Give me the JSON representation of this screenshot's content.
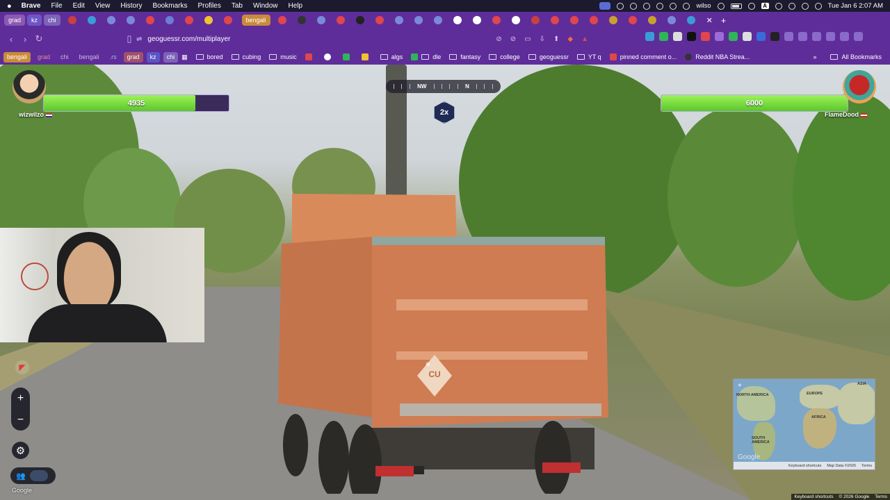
{
  "menubar": {
    "apple": "",
    "items": [
      "Brave",
      "File",
      "Edit",
      "View",
      "History",
      "Bookmarks",
      "Profiles",
      "Tab",
      "Window",
      "Help"
    ],
    "user": "wilso",
    "clock": "Tue Jan 6  2:07 AM",
    "input_badge": "A"
  },
  "tabs": {
    "group_grad": "grad",
    "group_kz": "kz",
    "group_chi": "chi",
    "group_bengali": "bengali"
  },
  "toolbar": {
    "url": "geoguessr.com/multiplayer"
  },
  "bookmarks": {
    "chips": [
      "bengali",
      "grad",
      "chi",
      "bengali",
      ".rs",
      "grad",
      "kz",
      "chi"
    ],
    "items": [
      "bored",
      "cubing",
      "music",
      "",
      "",
      "",
      "",
      "algs",
      "dle",
      "fantasy",
      "college",
      "geoguessr",
      "YT q",
      "pinned comment o...",
      "Reddit NBA Strea..."
    ],
    "all": "All Bookmarks"
  },
  "game": {
    "player_left": {
      "name": "wizwilzo",
      "health": 4935,
      "health_fraction": 0.82
    },
    "player_right": {
      "name": "FlameDood",
      "health": 6000,
      "health_fraction": 1.0
    },
    "compass": {
      "left": "NW",
      "right": "N"
    },
    "multiplier": "2x",
    "zoom_in": "+",
    "zoom_out": "−",
    "google_logo": "Google",
    "truck_plate_text": "CU",
    "minimap": {
      "labels": {
        "north_america": "NORTH AMERICA",
        "south_america": "SOUTH AMERICA",
        "europe": "EUROPE",
        "africa": "AFRICA",
        "asia": "ASIA"
      },
      "footer": [
        "Keyboard shortcuts",
        "Map Data ©2026",
        "Terms"
      ],
      "google": "Google"
    },
    "attribution": [
      "Keyboard shortcuts",
      "© 2026 Google",
      "Terms"
    ]
  },
  "colors": {
    "browser_bg": "#5e2d9a",
    "health_green": "#7ad93f",
    "health_empty": "#3a2c5a"
  }
}
